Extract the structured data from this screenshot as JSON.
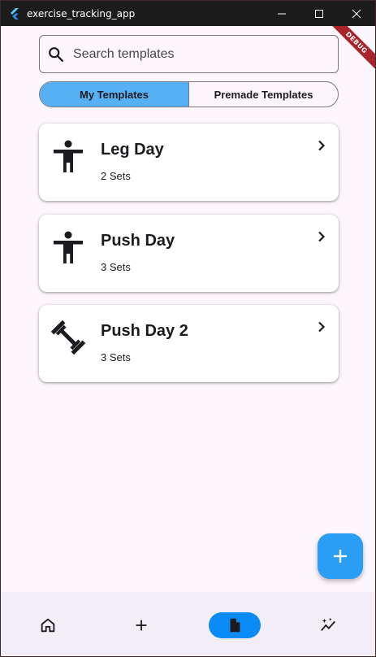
{
  "window": {
    "title": "exercise_tracking_app",
    "debug_label": "DEBUG"
  },
  "search": {
    "placeholder": "Search templates",
    "value": ""
  },
  "tabs": [
    {
      "label": "My Templates",
      "selected": true
    },
    {
      "label": "Premade Templates",
      "selected": false
    }
  ],
  "templates": [
    {
      "name": "Leg Day",
      "sets": "2 Sets",
      "icon": "accessibility-icon"
    },
    {
      "name": "Push Day",
      "sets": "3 Sets",
      "icon": "accessibility-icon"
    },
    {
      "name": "Push Day 2",
      "sets": "3 Sets",
      "icon": "dumbbell-icon"
    }
  ],
  "fab": {
    "icon": "add-icon"
  },
  "bottom_nav": [
    {
      "icon": "home-icon",
      "active": false
    },
    {
      "icon": "add-icon",
      "active": false
    },
    {
      "icon": "document-icon",
      "active": true
    },
    {
      "icon": "auto-graph-icon",
      "active": false
    }
  ],
  "colors": {
    "accent": "#58b0f4",
    "fab": "#2a9df4",
    "nav_active": "#0a8bf5",
    "background": "#fdf7fd"
  }
}
